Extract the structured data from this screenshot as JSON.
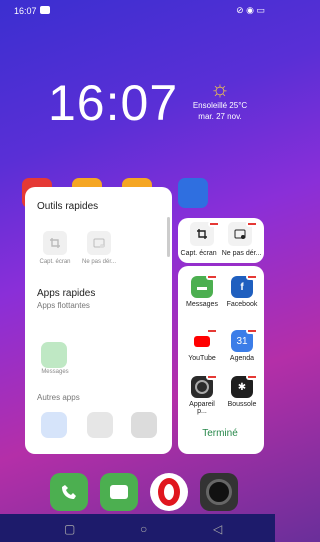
{
  "status": {
    "time": "16:07"
  },
  "clock": "16:07",
  "weather": {
    "line1": "Ensoleillé 25°C",
    "line2": "mar. 27 nov."
  },
  "left_panel": {
    "tools_title": "Outils rapides",
    "tools": [
      {
        "label": "Capt. écran"
      },
      {
        "label": "Ne pas dér..."
      }
    ],
    "apps_title": "Apps rapides",
    "apps_sub": "Apps flottantes",
    "floating_app": "Messages",
    "other_apps": "Autres apps"
  },
  "right_top": {
    "items": [
      {
        "label": "Capt. écran"
      },
      {
        "label": "Ne pas dér..."
      }
    ]
  },
  "right_apps": [
    {
      "label": "Messages",
      "color": "#4caf50"
    },
    {
      "label": "Facebook",
      "color": "#1f5fbf"
    },
    {
      "label": "YouTube",
      "color": "#ff0000"
    },
    {
      "label": "Agenda",
      "color": "#3b7de8",
      "badge_text": "31"
    },
    {
      "label": "Appareil p...",
      "color": "#2b2b2b"
    },
    {
      "label": "Boussole",
      "color": "#1f1f1f"
    }
  ],
  "done": "Terminé"
}
